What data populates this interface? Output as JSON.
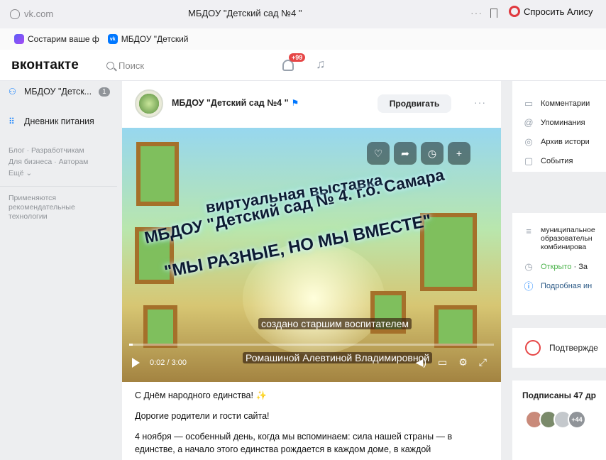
{
  "browser": {
    "url": "vk.com",
    "title": "МБДОУ \"Детский сад №4 \"",
    "more": "···",
    "alice": "Спросить Алису"
  },
  "bookmarks": [
    {
      "label": "Состарим ваше ф"
    },
    {
      "label": "МБДОУ \"Детский"
    }
  ],
  "header": {
    "logo": "вконтакте",
    "search_placeholder": "Поиск",
    "notif_badge": "+99"
  },
  "sidebar": {
    "items": [
      {
        "label": "МБДОУ \"Детск...",
        "count": "1"
      },
      {
        "label": "Дневник питания"
      }
    ],
    "links_line1": "Блог · Разработчикам",
    "links_line2": "Для бизнеса · Авторам",
    "more": "Ещё ⌄",
    "note": "Применяются рекомендательные технологии"
  },
  "post": {
    "group_name": "МБДОУ \"Детский сад №4 \"",
    "promote": "Продвигать",
    "video": {
      "line1": "виртуальная выставка",
      "line2": "МБДОУ \"Детский сад № 4. г.о. Самара",
      "line3": "\"МЫ РАЗНЫЕ, НО МЫ ВМЕСТЕ\"",
      "caption1": "создано старшим воспитателем",
      "caption2": "Ромашиной Алевтиной Владимировной",
      "time": "0:02 / 3:00",
      "progress": 0.01
    },
    "text": [
      "С Днём народного единства! ✨",
      "Дорогие родители и гости сайта!",
      "4 ноября — особенный день, когда мы вспоминаем: сила нашей страны — в единстве, а начало этого единства рождается в каждом доме, в каждой"
    ]
  },
  "right": {
    "top_items": [
      {
        "label": "Комментарии",
        "icon": "comment-icon"
      },
      {
        "label": "Упоминания",
        "icon": "at-icon"
      },
      {
        "label": "Архив истори",
        "icon": "archive-icon"
      },
      {
        "label": "События",
        "icon": "events-icon"
      }
    ],
    "info_text": "муниципальное образовательн комбинирова",
    "open_label": "Открыто",
    "open_suffix": " · За",
    "details": "Подробная ин",
    "confirm": "Подтвержде",
    "subs_title": "Подписаны 47 др",
    "subs_more": "+44"
  },
  "colors": {
    "accent": "#0077ff",
    "badge": "#e64646",
    "open": "#4bb34b"
  }
}
